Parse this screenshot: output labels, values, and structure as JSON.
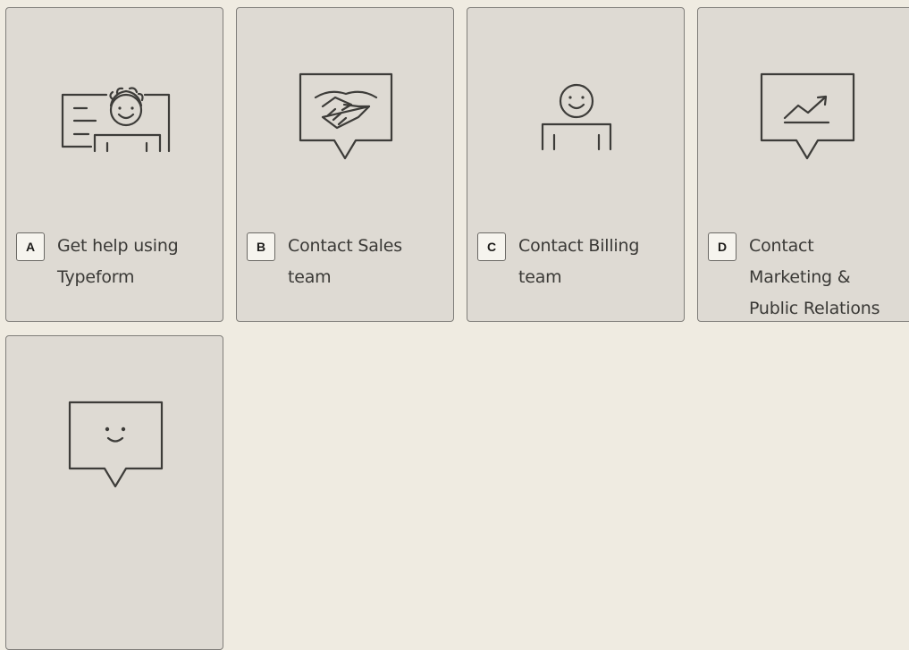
{
  "choices": [
    {
      "key": "A",
      "label_line1": "Get help using",
      "label_line2": "Typeform",
      "label_line3": "",
      "icon": "support-person-icon"
    },
    {
      "key": "B",
      "label_line1": "Contact Sales",
      "label_line2": "team",
      "label_line3": "",
      "icon": "handshake-icon"
    },
    {
      "key": "C",
      "label_line1": "Contact Billing",
      "label_line2": "team",
      "label_line3": "",
      "icon": "person-icon"
    },
    {
      "key": "D",
      "label_line1": "Contact",
      "label_line2": "Marketing &",
      "label_line3": "Public Relations",
      "icon": "trending-chart-icon"
    },
    {
      "key": "",
      "label_line1": "",
      "label_line2": "",
      "label_line3": "",
      "icon": "smiley-chat-icon"
    }
  ],
  "colors": {
    "page_background": "#efebe1",
    "card_background": "#dedad3",
    "card_border": "#807e7a",
    "icon_stroke": "#3d3c39",
    "text": "#3a3936"
  }
}
